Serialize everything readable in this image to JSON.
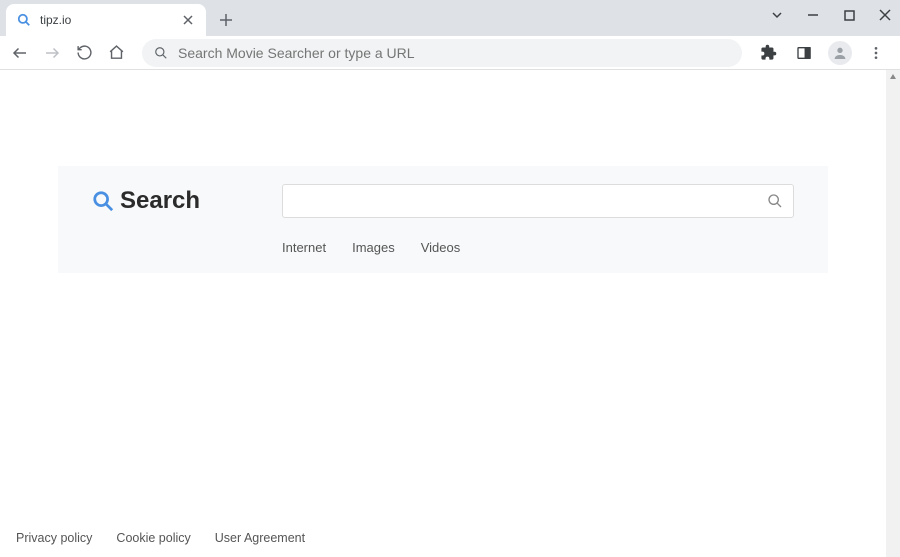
{
  "window": {
    "tab_title": "tipz.io"
  },
  "toolbar": {
    "omnibox_placeholder": "Search Movie Searcher or type a URL"
  },
  "page": {
    "brand_label": "Search",
    "search_value": "",
    "tabs": [
      "Internet",
      "Images",
      "Videos"
    ],
    "footer_links": [
      "Privacy policy",
      "Cookie policy",
      "User Agreement"
    ]
  }
}
